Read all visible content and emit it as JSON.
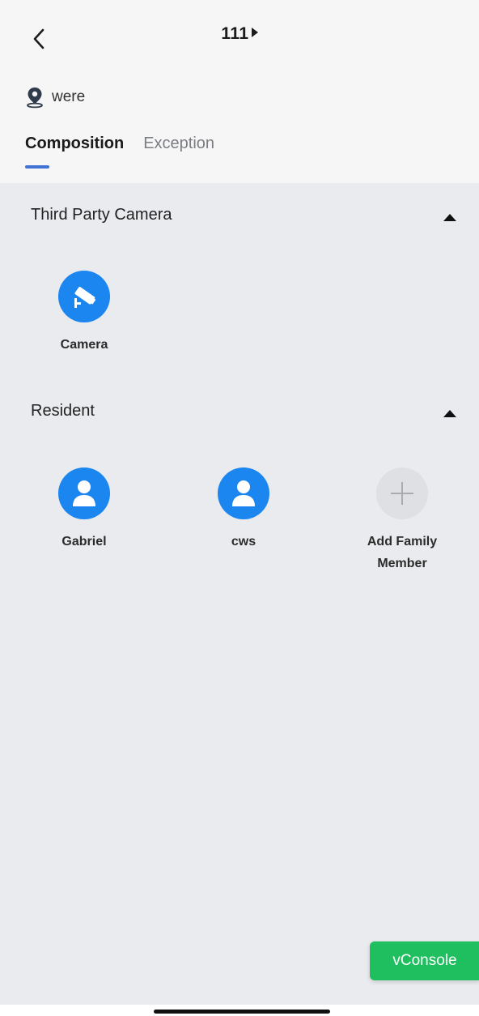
{
  "header": {
    "title": "111",
    "location": "were"
  },
  "tabs": [
    {
      "label": "Composition",
      "active": true
    },
    {
      "label": "Exception",
      "active": false
    }
  ],
  "sections": {
    "camera": {
      "title": "Third Party Camera",
      "items": [
        {
          "label": "Camera",
          "icon": "cctv-camera-icon"
        }
      ]
    },
    "resident": {
      "title": "Resident",
      "items": [
        {
          "label": "Gabriel",
          "icon": "person-icon"
        },
        {
          "label": "cws",
          "icon": "person-icon"
        },
        {
          "label": "Add Family\nMember",
          "icon": "plus-icon"
        }
      ]
    }
  },
  "vconsole": {
    "label": "vConsole"
  },
  "colors": {
    "accent": "#1b85f0",
    "tab_indicator": "#4173d6",
    "vconsole": "#1fbf5f",
    "background": "#e9ebef"
  }
}
